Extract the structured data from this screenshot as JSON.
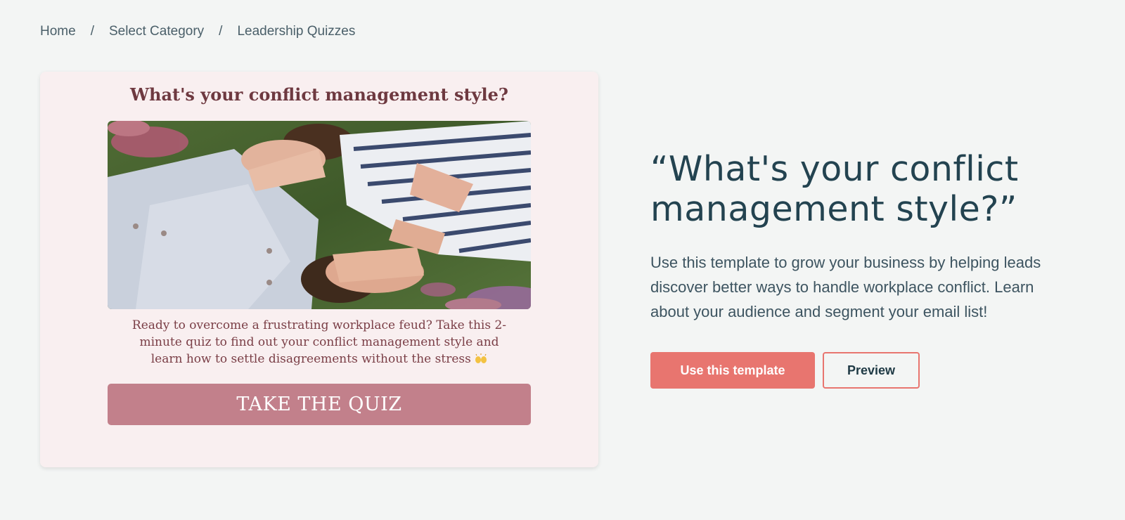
{
  "breadcrumb": {
    "items": [
      "Home",
      "Select Category",
      "Leadership Quizzes"
    ],
    "separator": "/"
  },
  "card": {
    "title": "What's your conflict management style?",
    "image_alt": "two women lying in a field of flowers covering each other's eyes",
    "description": "Ready to overcome a frustrating workplace feud? Take this 2-minute quiz to find out your conflict management style and learn how to settle disagreements without the stress",
    "emoji_icon": "raising-hands-emoji",
    "cta_label": "TAKE THE QUIZ",
    "colors": {
      "background": "#f9eff0",
      "title": "#6e3940",
      "cta": "#c2808b"
    }
  },
  "info": {
    "title": "“What's your conflict management style?”",
    "description": "Use this template to grow your business by helping leads discover better ways to handle workplace conflict. Learn about your audience and segment your email list!",
    "primary_button": "Use this template",
    "secondary_button": "Preview",
    "colors": {
      "accent": "#e8756f",
      "title": "#234350"
    }
  }
}
